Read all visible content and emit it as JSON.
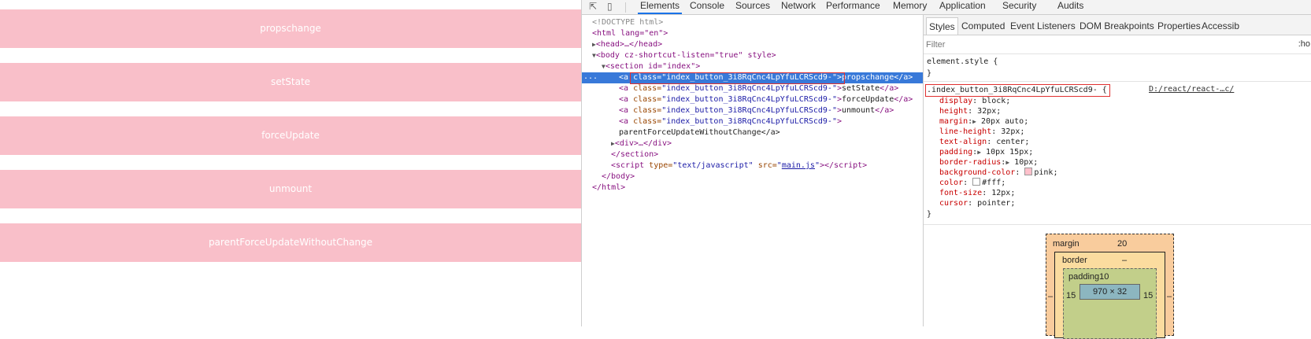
{
  "page": {
    "buttons": [
      "propschange",
      "setState",
      "forceUpdate",
      "unmount",
      "parentForceUpdateWithoutChange"
    ],
    "button_bg": "#f9bfc9"
  },
  "devtools": {
    "toolbar_icons": [
      "inspect-element-icon",
      "device-toolbar-icon"
    ],
    "tabs": [
      "Elements",
      "Console",
      "Sources",
      "Network",
      "Performance",
      "Memory",
      "Application",
      "Security",
      "Audits"
    ],
    "active_tab": "Elements",
    "dom": {
      "doctype": "<!DOCTYPE html>",
      "html_open": "<html lang=\"en\">",
      "head": "<head>…</head>",
      "body_open": "<body cz-shortcut-listen=\"true\" style>",
      "section_open": "<section id=\"index\">",
      "anchor_class": "index_button_3i8RqCnc4LpYfuLCRScd9-",
      "anchors": [
        "propschange",
        "setState",
        "forceUpdate",
        "unmount"
      ],
      "last_anchor_text": "parentForceUpdateWithoutChange</a>",
      "div": "<div>…</div>",
      "section_close": "</section>",
      "script_type": "text/javascript",
      "script_src": "main.js",
      "body_close": "</body>",
      "html_close": "</html>",
      "ellipsis": "..."
    },
    "side_tabs": [
      "Styles",
      "Computed",
      "Event Listeners",
      "DOM Breakpoints",
      "Properties",
      "Accessib"
    ],
    "active_side_tab": "Styles",
    "filter_placeholder": "Filter",
    "hov_label": ":ho",
    "element_style": "element.style {",
    "rule_selector": ".index_button_3i8RqCnc4LpYfuLCRScd9-",
    "rule_source": "D:/react/react-…c/",
    "declarations": [
      {
        "prop": "display",
        "value": "block;"
      },
      {
        "prop": "height",
        "value": "32px;"
      },
      {
        "prop": "margin",
        "value": "20px auto;"
      },
      {
        "prop": "line-height",
        "value": "32px;"
      },
      {
        "prop": "text-align",
        "value": "center;"
      },
      {
        "prop": "padding",
        "value": "10px 15px;"
      },
      {
        "prop": "border-radius",
        "value": "10px;"
      },
      {
        "prop": "background-color",
        "value": "pink;",
        "swatch": "#ffc0cb"
      },
      {
        "prop": "color",
        "value": "#fff;",
        "swatch": "#ffffff"
      },
      {
        "prop": "font-size",
        "value": "12px;"
      },
      {
        "prop": "cursor",
        "value": "pointer;"
      }
    ],
    "box_model": {
      "margin_label": "margin",
      "margin_value": "20",
      "border_label": "border",
      "border_value": "–",
      "padding_label": "padding10",
      "left": "15",
      "right": "15",
      "content": "970 × 32",
      "outer_left": "–",
      "outer_right": "–"
    }
  }
}
